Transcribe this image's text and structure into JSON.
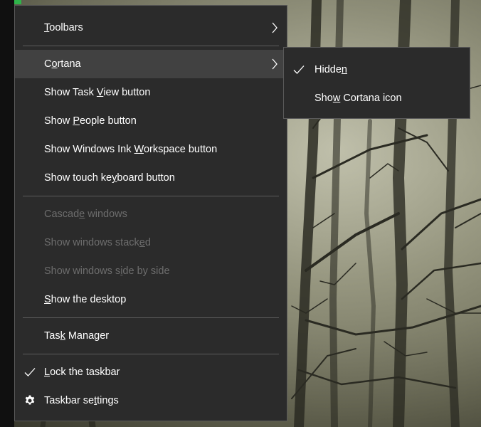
{
  "menu": {
    "toolbars": {
      "pre": "",
      "key": "T",
      "post": "oolbars"
    },
    "cortana": {
      "pre": "C",
      "key": "o",
      "post": "rtana"
    },
    "show_task_view": {
      "pre": "Show Task ",
      "key": "V",
      "post": "iew button"
    },
    "show_people": {
      "pre": "Show ",
      "key": "P",
      "post": "eople button"
    },
    "show_ink": {
      "pre": "Show Windows Ink ",
      "key": "W",
      "post": "orkspace button"
    },
    "show_touch_keyboard": {
      "pre": "Show touch ke",
      "key": "y",
      "post": "board button"
    },
    "cascade_windows": {
      "pre": "Cascad",
      "key": "e",
      "post": " windows"
    },
    "windows_stacked": {
      "pre": "Show windows stack",
      "key": "e",
      "post": "d"
    },
    "windows_side_by_side": {
      "pre": "Show windows s",
      "key": "i",
      "post": "de by side"
    },
    "show_desktop": {
      "pre": "",
      "key": "S",
      "post": "how the desktop"
    },
    "task_manager": {
      "pre": "Tas",
      "key": "k",
      "post": " Manager"
    },
    "lock_taskbar": {
      "pre": "",
      "key": "L",
      "post": "ock the taskbar"
    },
    "taskbar_settings": {
      "pre": "Taskbar se",
      "key": "t",
      "post": "tings"
    }
  },
  "submenu": {
    "hidden": {
      "pre": "Hidde",
      "key": "n",
      "post": ""
    },
    "show_cortana_icon": {
      "pre": "Sho",
      "key": "w",
      "post": " Cortana icon"
    }
  },
  "icons": {
    "submenu_arrow": "chevron-right-icon",
    "checked": "checkmark-icon",
    "settings": "gear-icon"
  },
  "colors": {
    "menu_background": "#2b2b2b",
    "highlight": "#414141",
    "disabled_text": "#6d6d6d",
    "text": "#ffffff",
    "taskbar_app_indicator": "#2fb34a"
  }
}
